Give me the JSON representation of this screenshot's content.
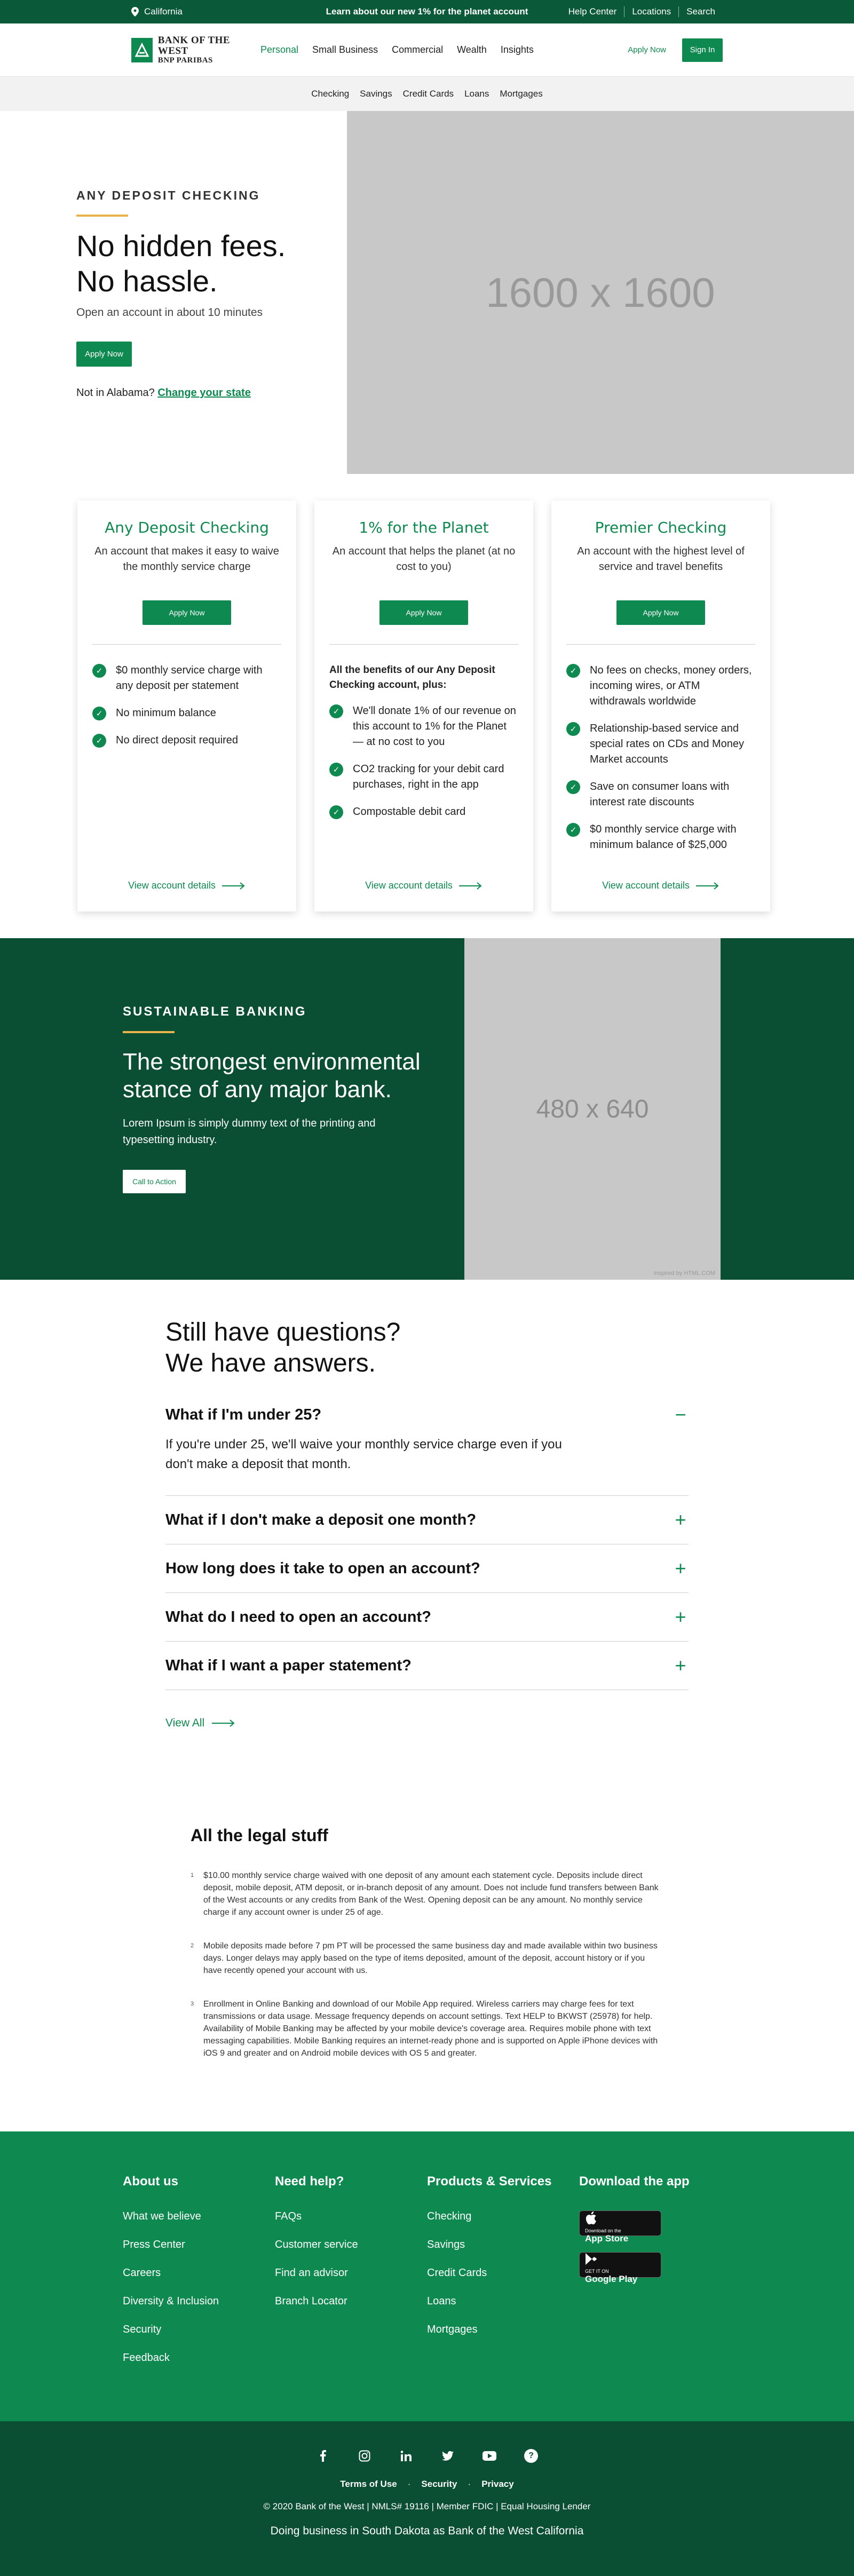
{
  "topbar": {
    "location": "California",
    "promo": "Learn about our new 1% for the planet account",
    "links": [
      "Help Center",
      "Locations",
      "Search"
    ]
  },
  "header": {
    "logo_line1": "BANK OF THE WEST",
    "logo_line2": "BNP PARIBAS",
    "nav": [
      "Personal",
      "Small Business",
      "Commercial",
      "Wealth",
      "Insights"
    ],
    "apply_now": "Apply Now",
    "sign_in": "Sign In"
  },
  "subnav": [
    "Checking",
    "Savings",
    "Credit Cards",
    "Loans",
    "Mortgages"
  ],
  "hero": {
    "eyebrow": "ANY DEPOSIT CHECKING",
    "title_line1": "No hidden fees.",
    "title_line2": "No hassle.",
    "subtitle": "Open an account in about 10 minutes",
    "button": "Apply Now",
    "state_text": "Not in Alabama?",
    "state_link": "Change your state",
    "image_placeholder": "1600 x 1600"
  },
  "cards": [
    {
      "title": "Any Deposit Checking",
      "desc": "An account that makes it easy to waive the monthly service charge",
      "button": "Apply Now",
      "lead": "",
      "features": [
        "$0 monthly service charge with any deposit per statement",
        "No minimum balance",
        "No direct deposit required"
      ],
      "link": "View account details"
    },
    {
      "title": "1% for the Planet",
      "desc": "An account that helps the planet (at no cost to you)",
      "button": "Apply Now",
      "lead": "All the benefits of our Any Deposit Checking account, plus:",
      "features": [
        "We'll donate 1% of our revenue on this account to 1% for the Planet — at no cost to you",
        "CO2 tracking for your debit card purchases, right in the app",
        "Compostable debit card"
      ],
      "link": "View account details"
    },
    {
      "title": "Premier Checking",
      "desc": "An account with the highest level of service and travel benefits",
      "button": "Apply Now",
      "lead": "",
      "features": [
        "No fees on checks, money orders, incoming wires, or ATM withdrawals worldwide",
        "Relationship-based service and special rates on CDs and Money Market accounts",
        "Save on consumer loans with interest rate discounts",
        "$0 monthly service charge with minimum balance of $25,000"
      ],
      "link": "View account details"
    }
  ],
  "sustainable": {
    "eyebrow": "SUSTAINABLE BANKING",
    "title": "The strongest environmental stance of any major bank.",
    "body": "Lorem Ipsum is simply dummy text of the printing and typesetting industry.",
    "button": "Call to Action",
    "image_placeholder": "480 x 640",
    "credit": "Inspired by HTML.COM"
  },
  "faq": {
    "title_line1": "Still have questions?",
    "title_line2": "We have answers.",
    "items": [
      {
        "q": "What if I'm under 25?",
        "a": "If you're under 25, we'll waive your monthly service charge even if you don't make a deposit that month."
      },
      {
        "q": "What if I don't make a deposit one month?"
      },
      {
        "q": "How long does it take to open an account?"
      },
      {
        "q": "What do I need to open an account?"
      },
      {
        "q": "What if I want a paper statement?"
      }
    ],
    "view_all": "View All"
  },
  "legal": {
    "title": "All the legal stuff",
    "items": [
      {
        "n": "1",
        "text": "$10.00 monthly service charge waived with one deposit of any amount each statement cycle. Deposits include direct deposit, mobile deposit, ATM deposit, or in-branch deposit of any amount. Does not include fund transfers between Bank of the West accounts or any credits from Bank of the West. Opening deposit can be any amount. No monthly service charge if any account owner is under 25 of age."
      },
      {
        "n": "2",
        "text": "Mobile deposits made before 7 pm PT will be processed the same business day and made available within two business days. Longer delays may apply based on the type of items deposited, amount of the deposit, account history or if you have recently opened your account with us."
      },
      {
        "n": "3",
        "text": "Enrollment in Online Banking and download of our Mobile App required. Wireless carriers may charge fees for text transmissions or data usage. Message frequency depends on account settings. Text HELP to BKWST (25978) for help. Availability of Mobile Banking may be affected by your mobile device's coverage area. Requires mobile phone with text messaging capabilities. Mobile Banking requires an internet-ready phone and is supported on Apple iPhone devices with iOS 9 and greater and on Android mobile devices with OS 5 and greater."
      }
    ]
  },
  "footer": {
    "about": {
      "title": "About us",
      "links": [
        "What we believe",
        "Press Center",
        "Careers",
        "Diversity & Inclusion",
        "Security",
        "Feedback"
      ]
    },
    "help": {
      "title": "Need help?",
      "links": [
        "FAQs",
        "Customer service",
        "Find an advisor",
        "Branch Locator"
      ]
    },
    "products": {
      "title": "Products & Services",
      "links": [
        "Checking",
        "Savings",
        "Credit Cards",
        "Loans",
        "Mortgages"
      ]
    },
    "app": {
      "title": "Download the app",
      "appstore_small": "Download on the",
      "appstore_big": "App Store",
      "gplay_small": "GET IT ON",
      "gplay_big": "Google Play"
    }
  },
  "footer_bottom": {
    "links": [
      "Terms of Use",
      "Security",
      "Privacy"
    ],
    "copyright": "© 2020 Bank of the West | NMLS# 19116 | Member FDIC | Equal Housing Lender",
    "doing_business": "Doing business in South Dakota as Bank of the West California"
  },
  "colors": {
    "brand_green": "#0e8a50",
    "dark_green": "#0a4f34",
    "accent_gold": "#e7b34a"
  }
}
